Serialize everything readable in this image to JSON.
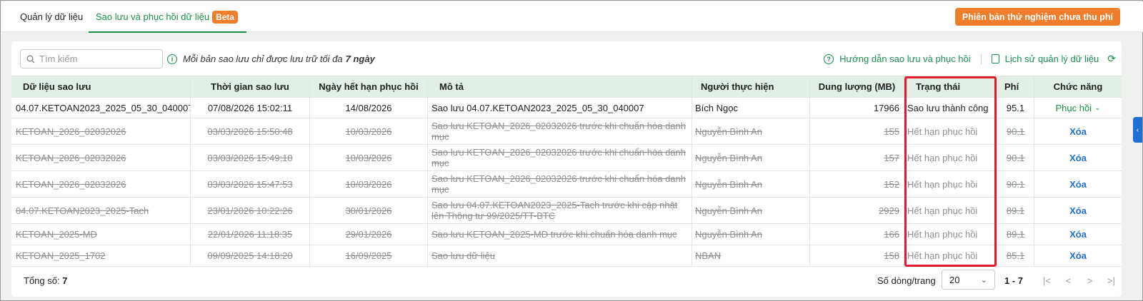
{
  "tabs": [
    {
      "label": "Quản lý dữ liệu"
    },
    {
      "label": "Sao lưu và phục hồi dữ liệu",
      "badge": "Beta"
    }
  ],
  "trial_button": "Phiên bản thử nghiệm chưa thu phí",
  "search": {
    "placeholder": "Tìm kiếm"
  },
  "notice": {
    "text": "Mỗi bản sao lưu chỉ được lưu trữ tối đa",
    "bold": "7 ngày"
  },
  "links": {
    "guide": "Hướng dẫn sao lưu và phục hồi",
    "history": "Lịch sử quản lý dữ liệu"
  },
  "columns": [
    "Dữ liệu sao lưu",
    "Thời gian sao lưu",
    "Ngày hết hạn phục hồi",
    "Mô tả",
    "Người thực hiện",
    "Dung lượng (MB)",
    "Trạng thái",
    "Phí",
    "Chức năng"
  ],
  "rows": [
    {
      "name": "04.07.KETOAN2023_2025_05_30_040007",
      "time": "07/08/2026 15:02:11",
      "expire": "14/08/2026",
      "desc": "Sao lưu 04.07.KETOAN2023_2025_05_30_040007",
      "user": "Bích Ngọc",
      "size": "17966",
      "status": "Sao lưu thành công",
      "fee": "95.1",
      "action": "Phục hồi"
    },
    {
      "name": "KETOAN_2026_02032026",
      "time": "03/03/2026 15:50:48",
      "expire": "10/03/2026",
      "desc": "Sao lưu KETOAN_2026_02032026 trước khi chuẩn hóa danh mục",
      "user": "Nguyễn Bình An",
      "size": "155",
      "status": "Hết hạn phục hồi",
      "fee": "90.1",
      "action": "Xóa"
    },
    {
      "name": "KETOAN_2026_02032026",
      "time": "03/03/2026 15:49:10",
      "expire": "10/03/2026",
      "desc": "Sao lưu KETOAN_2026_02032026 trước khi chuẩn hóa danh mục",
      "user": "Nguyễn Bình An",
      "size": "157",
      "status": "Hết hạn phục hồi",
      "fee": "90.1",
      "action": "Xóa"
    },
    {
      "name": "KETOAN_2026_02032026",
      "time": "03/03/2026 15:47:53",
      "expire": "10/03/2026",
      "desc": "Sao lưu KETOAN_2026_02032026 trước khi chuẩn hóa danh mục",
      "user": "Nguyễn Bình An",
      "size": "152",
      "status": "Hết hạn phục hồi",
      "fee": "90.1",
      "action": "Xóa"
    },
    {
      "name": "04.07.KETOAN2023_2025-Tach",
      "time": "23/01/2026 10:22:26",
      "expire": "30/01/2026",
      "desc": "Sao lưu 04.07.KETOAN2023_2025-Tach trước khi cập nhật lên Thông tư 99/2025/TT-BTC",
      "user": "Nguyễn Bình An",
      "size": "2929",
      "status": "Hết hạn phục hồi",
      "fee": "89.1",
      "action": "Xóa"
    },
    {
      "name": "KETOAN_2025-MD",
      "time": "22/01/2026 11:18:35",
      "expire": "29/01/2026",
      "desc": "Sao lưu KETOAN_2025-MD trước khi chuẩn hóa danh mục",
      "user": "Nguyễn Bình An",
      "size": "166",
      "status": "Hết hạn phục hồi",
      "fee": "89.1",
      "action": "Xóa"
    },
    {
      "name": "KETOAN_2025_1702",
      "time": "09/09/2025 14:18:20",
      "expire": "16/09/2025",
      "desc": "Sao lưu dữ liệu",
      "user": "NBAN",
      "size": "158",
      "status": "Hết hạn phục hồi",
      "fee": "85.1",
      "action": "Xóa"
    }
  ],
  "footer": {
    "total_label": "Tổng số:",
    "total": "7",
    "rows_per_page_label": "Số dòng/trang",
    "rows_per_page": "20",
    "range": "1 - 7"
  },
  "colors": {
    "accent": "#1a8f4a",
    "orange": "#f07d2a",
    "link": "#1f6fd1",
    "highlight": "#e01b2e"
  }
}
